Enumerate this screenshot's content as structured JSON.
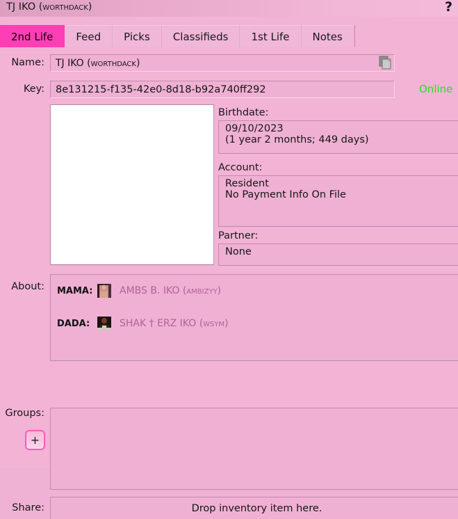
{
  "window": {
    "title": "TJ IKO (worthdack)",
    "help_icon": "?"
  },
  "tabs": [
    {
      "label": "2nd Life",
      "active": true
    },
    {
      "label": "Feed",
      "active": false
    },
    {
      "label": "Picks",
      "active": false
    },
    {
      "label": "Classifieds",
      "active": false
    },
    {
      "label": "1st Life",
      "active": false
    },
    {
      "label": "Notes",
      "active": false
    }
  ],
  "fields": {
    "name_label": "Name:",
    "name_value": "TJ IKO (worthdack)",
    "key_label": "Key:",
    "key_value": "8e131215-f135-42e0-8d18-b92a740ff292",
    "status": "Online",
    "copy_icon": "copy-icon"
  },
  "details": {
    "birthdate_label": "Birthdate:",
    "birthdate_value": "09/10/2023",
    "birthdate_age": "(1 year 2 months; 449 days)",
    "account_label": "Account:",
    "account_type": "Resident",
    "account_payment": "No Payment Info On File",
    "partner_label": "Partner:",
    "partner_value": "None"
  },
  "about": {
    "label": "About:",
    "entries": [
      {
        "role": "MAMA:",
        "name": "AMBS B. IKO (ambizyy)"
      },
      {
        "role": "DADA:",
        "name": "SHAK † ERZ IKO (wsym)"
      }
    ]
  },
  "groups": {
    "label": "Groups:",
    "add_button": "+",
    "items": []
  },
  "share": {
    "label": "Share:",
    "hint": "Drop inventory item here."
  },
  "colors": {
    "window_bg": "#f2b3d5",
    "active_tab": "#fc3fb4",
    "online_green": "#22e024",
    "link_mauve": "#b0629a",
    "field_bg": "#efb0d3"
  }
}
